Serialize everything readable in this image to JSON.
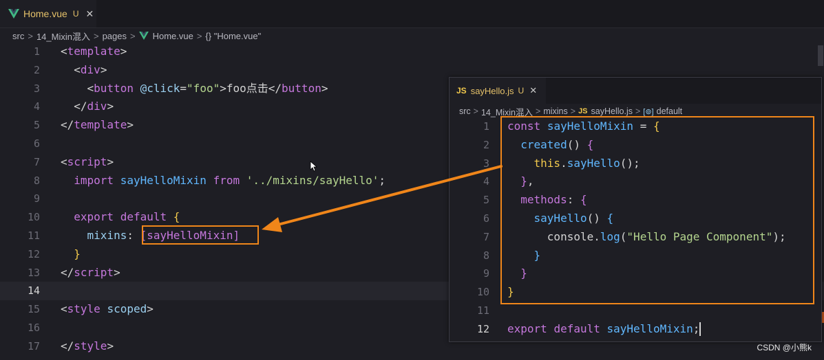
{
  "main_editor": {
    "tab": {
      "name": "Home.vue",
      "badge": "U",
      "close": "✕"
    },
    "breadcrumb": [
      "src",
      "14_Mixin混入",
      "pages",
      "Home.vue",
      "{} \"Home.vue\""
    ],
    "breadcrumb_sep": ">",
    "line_numbers": [
      "1",
      "2",
      "3",
      "4",
      "5",
      "6",
      "7",
      "8",
      "9",
      "10",
      "11",
      "12",
      "13",
      "14",
      "15",
      "16",
      "17"
    ],
    "code": {
      "l1": {
        "open": "<",
        "tag": "template",
        "close": ">"
      },
      "l2": {
        "open": "<",
        "tag": "div",
        "close": ">"
      },
      "l3": {
        "open": "<",
        "tag": "button",
        "attr": "@click",
        "eq": "=",
        "val": "\"foo\"",
        "gt": ">",
        "text": "foo点击",
        "endopen": "</",
        "endtag": "button",
        "endclose": ">"
      },
      "l4": {
        "open": "</",
        "tag": "div",
        "close": ">"
      },
      "l5": {
        "open": "</",
        "tag": "template",
        "close": ">"
      },
      "l7": {
        "open": "<",
        "tag": "script",
        "close": ">"
      },
      "l8": {
        "kw1": "import",
        "name": "sayHelloMixin",
        "kw2": "from",
        "path": "'../mixins/sayHello'",
        "semi": ";"
      },
      "l10": {
        "kw1": "export",
        "kw2": "default",
        "brace": "{"
      },
      "l11": {
        "key": "mixins",
        "colon": ":",
        "value": "[sayHelloMixin]"
      },
      "l12": {
        "brace": "}"
      },
      "l13": {
        "open": "</",
        "tag": "script",
        "close": ">"
      },
      "l15": {
        "open": "<",
        "tag": "style",
        "attr": "scoped",
        "close": ">"
      },
      "l17": {
        "open": "</",
        "tag": "style",
        "close": ">"
      }
    }
  },
  "mixin_panel": {
    "tab": {
      "icon": "JS",
      "name": "sayHello.js",
      "badge": "U",
      "close": "✕"
    },
    "breadcrumb": [
      "src",
      "14_Mixin混入",
      "mixins",
      "sayHello.js",
      "default"
    ],
    "breadcrumb_js": "JS",
    "breadcrumb_symbol": "[⊚]",
    "line_numbers": [
      "1",
      "2",
      "3",
      "4",
      "5",
      "6",
      "7",
      "8",
      "9",
      "10",
      "11",
      "12"
    ],
    "code": {
      "l1": {
        "kw": "const",
        "name": "sayHelloMixin",
        "eq": "=",
        "brace": "{"
      },
      "l2": {
        "fn": "created",
        "parens": "()",
        "brace": "{"
      },
      "l3": {
        "this": "this",
        "dot": ".",
        "fn": "sayHello",
        "rest": "();"
      },
      "l4": {
        "brace": "}",
        "comma": ","
      },
      "l5": {
        "key": "methods",
        "colon": ":",
        "brace": "{"
      },
      "l6": {
        "fn": "sayHello",
        "parens": "()",
        "brace": "{"
      },
      "l7": {
        "obj": "console",
        "dot": ".",
        "fn": "log",
        "open": "(",
        "str": "\"Hello Page Component\"",
        "close": ");"
      },
      "l8": {
        "brace": "}"
      },
      "l9": {
        "brace": "}"
      },
      "l10": {
        "brace": "}"
      },
      "l12": {
        "kw1": "export",
        "kw2": "default",
        "name": "sayHelloMixin",
        "semi": ";"
      }
    }
  },
  "watermark": "CSDN @小熊k",
  "colors": {
    "highlight": "#f0861a",
    "background": "#1e1e24"
  }
}
